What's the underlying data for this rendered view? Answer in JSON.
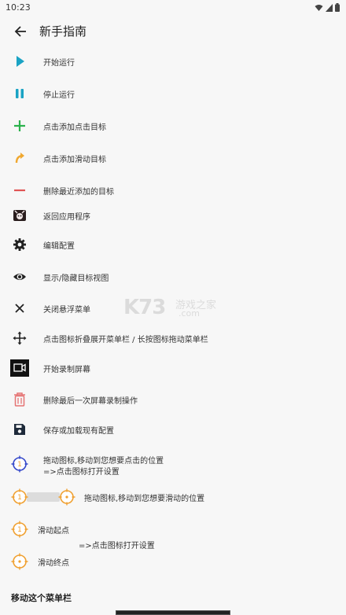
{
  "status_bar": {
    "time": "10:23"
  },
  "app_bar": {
    "title": "新手指南"
  },
  "items": [
    {
      "label": "开始运行"
    },
    {
      "label": "停止运行"
    },
    {
      "label": "点击添加点击目标"
    },
    {
      "label": "点击添加滑动目标"
    },
    {
      "label": "删除最近添加的目标"
    },
    {
      "label": "返回应用程序"
    },
    {
      "label": "编辑配置"
    },
    {
      "label": "显示/隐藏目标视图"
    },
    {
      "label": "关闭悬浮菜单"
    },
    {
      "label": "点击图标折叠展开菜单栏 / 长按图标拖动菜单栏"
    },
    {
      "label": "开始录制屏幕"
    },
    {
      "label": "删除最后一次屏幕录制操作"
    },
    {
      "label": "保存或加载现有配置"
    }
  ],
  "click_target": {
    "line1": "拖动图标,移动到您想要点击的位置",
    "line2": "=>点击图标打开设置",
    "number": "1"
  },
  "swipe_target": {
    "label": "拖动图标,移动到您想要滑动的位置",
    "number": "1"
  },
  "swipe_start": {
    "label": "滑动起点",
    "number": "1"
  },
  "swipe_hint": {
    "label": "=>点击图标打开设置"
  },
  "swipe_end": {
    "label": "滑动终点"
  },
  "section": {
    "title": "移动这个菜单栏"
  },
  "watermark": {
    "big": "K73",
    "cn": "游戏之家",
    "com": ".com"
  },
  "colors": {
    "play": "#1aa3c4",
    "add_green": "#2bb24c",
    "swipe_orange": "#f0a830",
    "remove_red": "#e05555",
    "trash_red": "#e57373",
    "target_blue": "#3346c9",
    "target_orange": "#f0a030"
  }
}
